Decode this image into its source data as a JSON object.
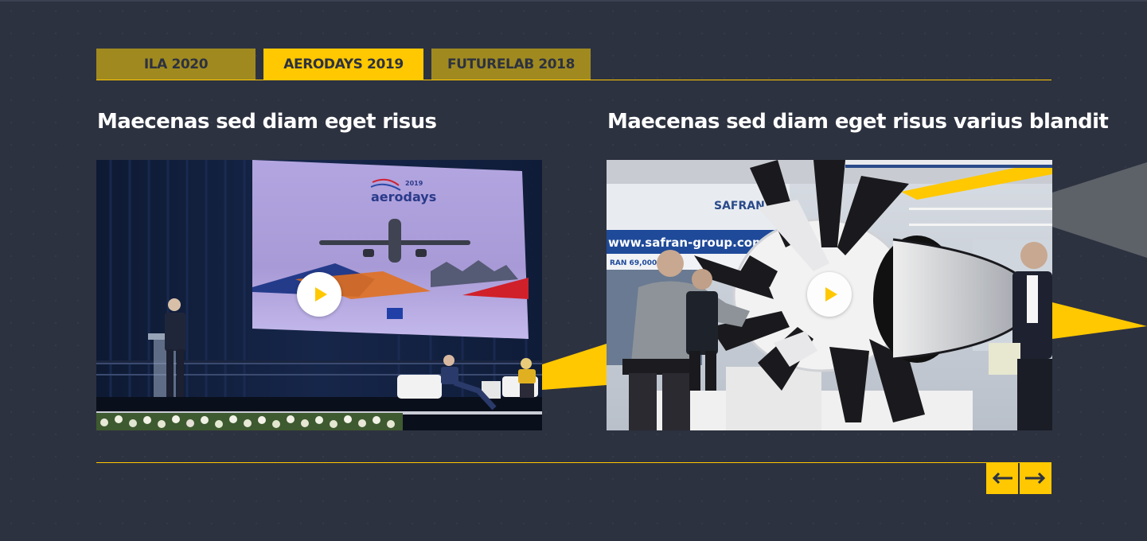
{
  "tabs": [
    {
      "label": "ILA 2020",
      "active": false
    },
    {
      "label": "AERODAYS 2019",
      "active": true
    },
    {
      "label": "FUTURELAB 2018",
      "active": false
    }
  ],
  "cards": [
    {
      "title": "Maecenas sed diam eget risus",
      "screen_text": {
        "year": "2019",
        "brand": "aerodays"
      }
    },
    {
      "title": "Maecenas sed diam eget risus varius blandit",
      "screen_text": {
        "brand": "SAFRAN",
        "url": "www.safran-group.com",
        "stand_text": "RAN 69,000 EM"
      }
    }
  ],
  "nav": {
    "prev_icon": "arrow-left-icon",
    "next_icon": "arrow-right-icon"
  },
  "colors": {
    "background": "#2d3240",
    "accent": "#ffc800",
    "tab_inactive": "#a08a1f",
    "title": "#ffffff"
  }
}
